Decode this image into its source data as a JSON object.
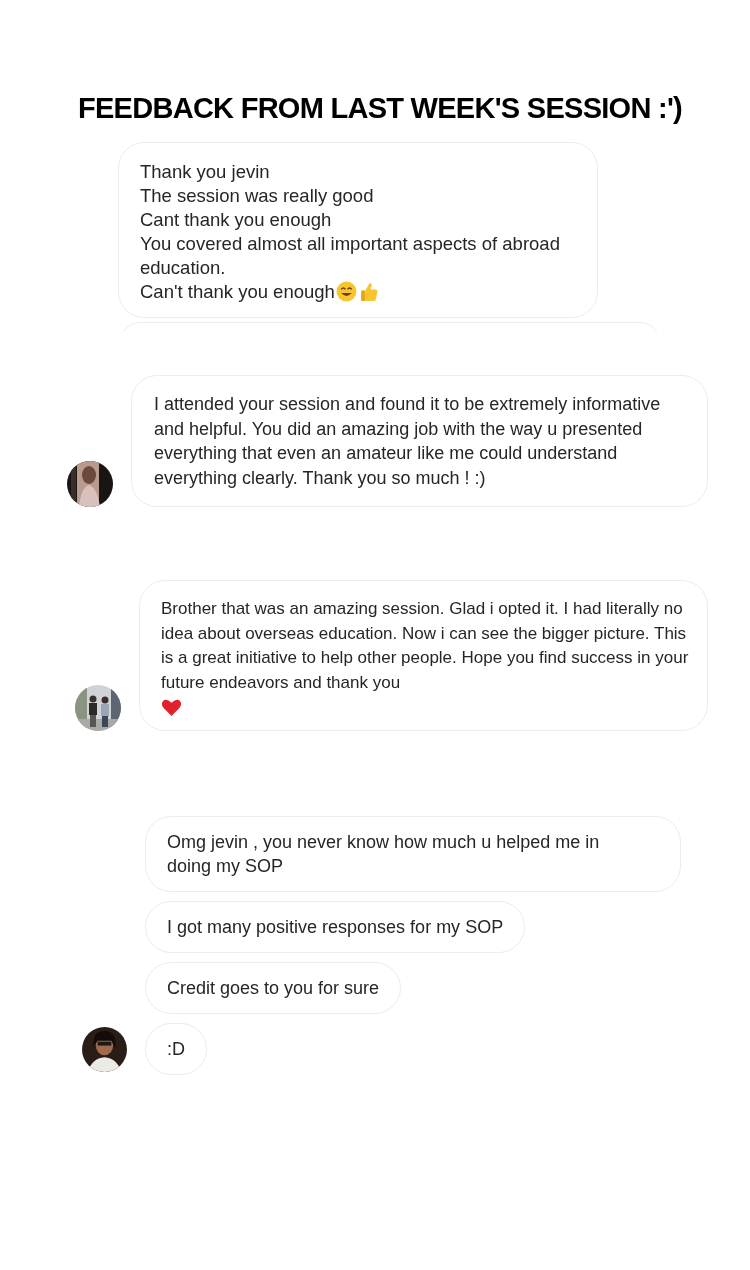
{
  "title": "FEEDBACK FROM LAST WEEK'S SESSION :')",
  "groups": [
    {
      "avatar": false,
      "messages": [
        {
          "lines": [
            "Thank you jevin",
            "The session was really good",
            "Cant thank you enough",
            "You covered almost all important aspects of abroad education.",
            "Can't thank you enough"
          ],
          "emoji": [
            {
              "kind": "smile"
            },
            {
              "kind": "thumbs-up"
            }
          ]
        }
      ]
    },
    {
      "avatar": true,
      "messages": [
        {
          "lines": [
            "I attended your session and found it to be extremely informative and helpful. You did an amazing job with the way u  presented everything that even an amateur like me could understand everything clearly. Thank you so much ! :)"
          ]
        }
      ]
    },
    {
      "avatar": true,
      "messages": [
        {
          "lines": [
            "Brother that was an amazing session. Glad i opted it. I had literally no idea about overseas education. Now i can see the bigger picture. This is a great initiative to help other people. Hope you find success in your future endeavors and thank you"
          ],
          "emoji": [
            {
              "kind": "heart"
            }
          ]
        }
      ]
    },
    {
      "avatar": true,
      "messages": [
        {
          "lines": [
            "Omg jevin , you never know how much u helped me in doing my SOP"
          ]
        },
        {
          "lines": [
            "I got many positive responses for my SOP"
          ]
        },
        {
          "lines": [
            "Credit goes to you for sure"
          ]
        },
        {
          "lines": [
            ":D"
          ]
        }
      ]
    }
  ]
}
